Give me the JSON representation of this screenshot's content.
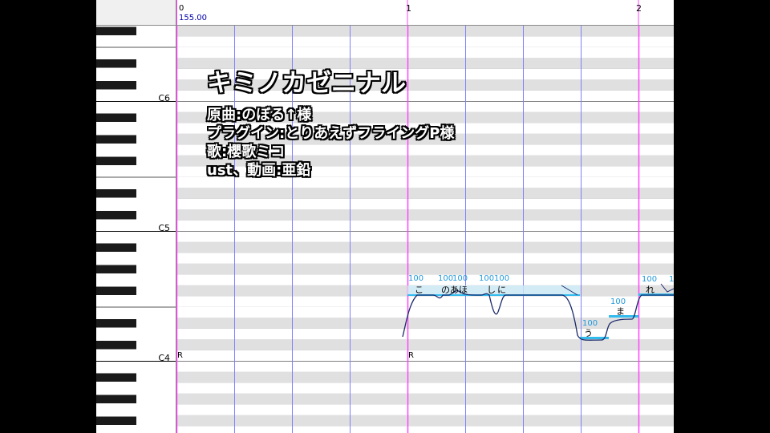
{
  "ruler": {
    "measures": [
      "0",
      "1",
      "2"
    ],
    "tempo": "155.00"
  },
  "keyboard": {
    "octave_labels": [
      "C6",
      "C5",
      "C4"
    ]
  },
  "overlay": {
    "title": "キミノカゼニナル",
    "lines": [
      "原曲:のぼる↑様",
      "プラグイン:とりあえずフライングP様",
      "歌:櫻歌ミコ",
      "ust、動画:亜鉛"
    ]
  },
  "rests": [
    "R",
    "R"
  ],
  "notes": [
    {
      "lyric": "こ",
      "intensity": "100"
    },
    {
      "lyric": "のあ",
      "intensity": "100"
    },
    {
      "lyric": "ほ",
      "intensity": "100"
    },
    {
      "lyric": "し",
      "intensity": "100"
    },
    {
      "lyric": "に",
      "intensity": "100"
    },
    {
      "lyric": "う",
      "intensity": "100"
    },
    {
      "lyric": "ま",
      "intensity": "100"
    },
    {
      "lyric": "れ",
      "intensity": "100"
    },
    {
      "lyric": "",
      "intensity": "1"
    }
  ],
  "colors": {
    "measure_line": "#ff44ff",
    "beat_line": "#8080ff",
    "stripe": "#e0e0e0",
    "note": "#33bbee",
    "intensity_text": "#2299dd",
    "pitch_curve": "#1a2a6a"
  }
}
